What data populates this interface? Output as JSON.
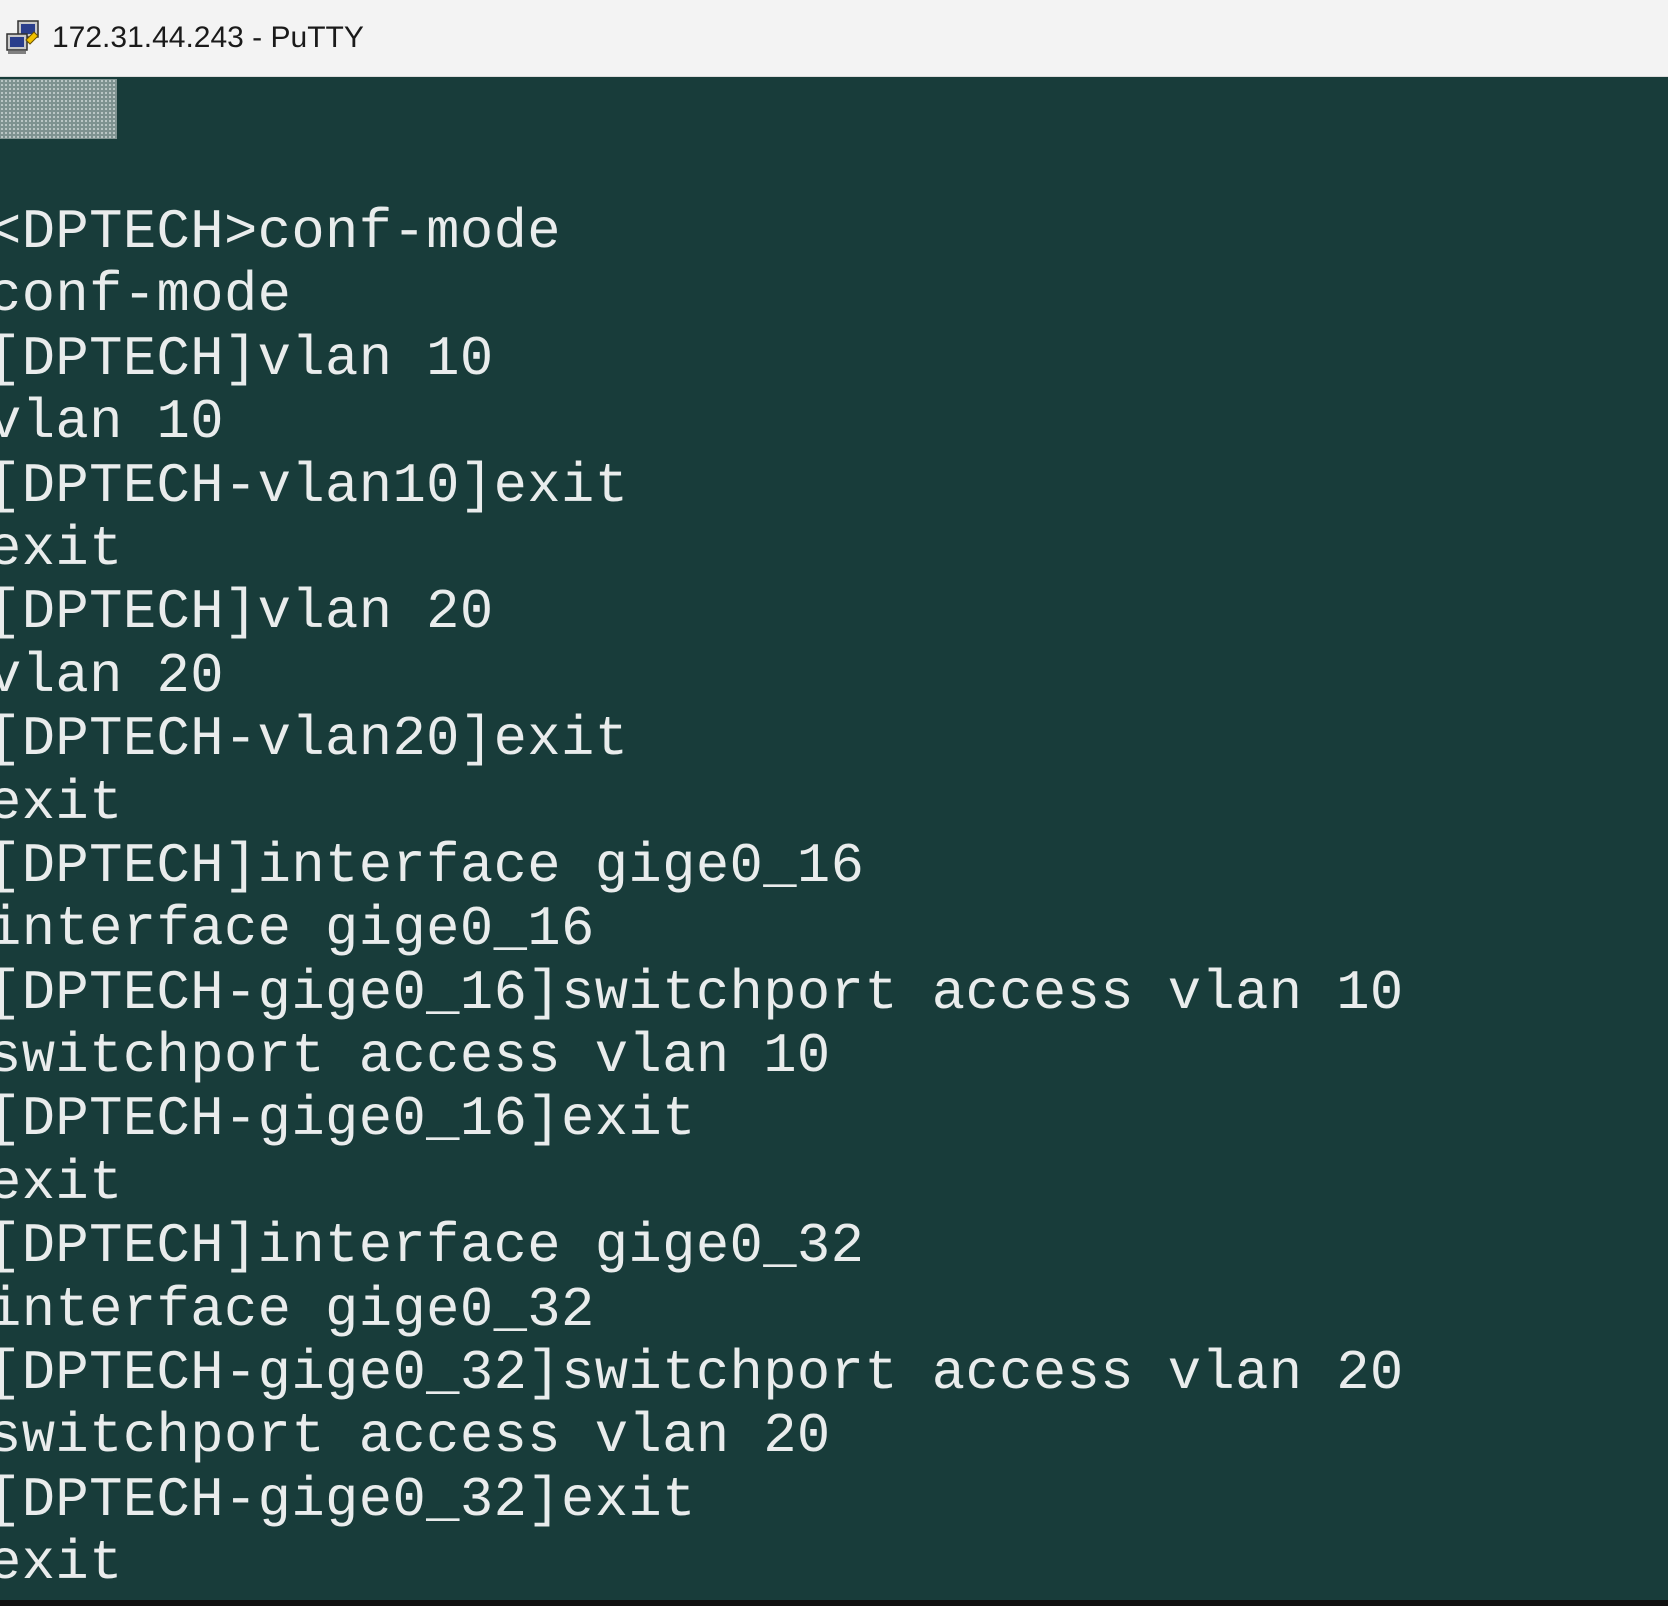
{
  "window": {
    "title": "172.31.44.243 - PuTTY",
    "icon": "putty-icon"
  },
  "colors": {
    "terminal_bg": "#183c3a",
    "terminal_fg": "#e9ecec",
    "titlebar_bg": "#f3f3f3"
  },
  "terminal": {
    "lines": [
      "<DPTECH>conf-mode",
      "conf-mode",
      "[DPTECH]vlan 10",
      "vlan 10",
      "[DPTECH-vlan10]exit",
      "exit",
      "[DPTECH]vlan 20",
      "vlan 20",
      "[DPTECH-vlan20]exit",
      "exit",
      "[DPTECH]interface gige0_16",
      "interface gige0_16",
      "[DPTECH-gige0_16]switchport access vlan 10",
      "switchport access vlan 10",
      "[DPTECH-gige0_16]exit",
      "exit",
      "[DPTECH]interface gige0_32",
      "interface gige0_32",
      "[DPTECH-gige0_32]switchport access vlan 20",
      "switchport access vlan 20",
      "[DPTECH-gige0_32]exit",
      "exit"
    ]
  }
}
